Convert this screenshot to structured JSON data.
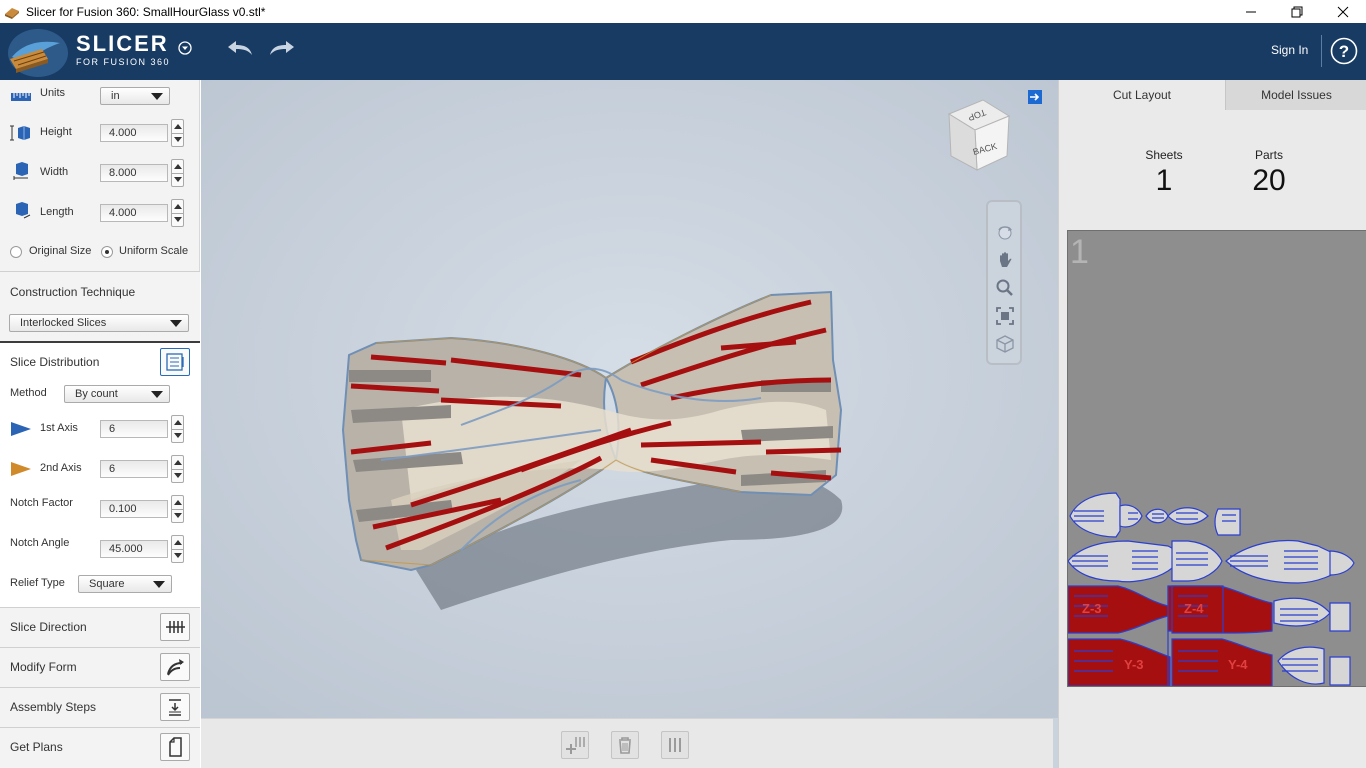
{
  "window": {
    "title": "Slicer for Fusion 360: SmallHourGlass v0.stl*"
  },
  "header": {
    "brand_title": "SLICER",
    "brand_subtitle": "FOR FUSION 360",
    "signin_label": "Sign In",
    "help_label": "?"
  },
  "dimensions": {
    "units_label": "Units",
    "units_value": "in",
    "height_label": "Height",
    "height_value": "4.000",
    "width_label": "Width",
    "width_value": "8.000",
    "length_label": "Length",
    "length_value": "4.000",
    "original_size_label": "Original Size",
    "uniform_scale_label": "Uniform Scale",
    "scale_mode": "Uniform Scale"
  },
  "construction": {
    "title": "Construction Technique",
    "value": "Interlocked Slices"
  },
  "slice_distribution": {
    "title": "Slice Distribution",
    "method_label": "Method",
    "method_value": "By count",
    "axis1_label": "1st Axis",
    "axis1_value": "6",
    "axis2_label": "2nd Axis",
    "axis2_value": "6",
    "notch_factor_label": "Notch Factor",
    "notch_factor_value": "0.100",
    "notch_angle_label": "Notch Angle",
    "notch_angle_value": "45.000",
    "relief_type_label": "Relief Type",
    "relief_type_value": "Square"
  },
  "sections": {
    "slice_direction": "Slice Direction",
    "modify_form": "Modify Form",
    "assembly_steps": "Assembly Steps",
    "get_plans": "Get Plans"
  },
  "viewcube": {
    "top_label": "TOP",
    "back_label": "BACK"
  },
  "right": {
    "tab_cut_layout": "Cut Layout",
    "tab_model_issues": "Model Issues",
    "sheets_label": "Sheets",
    "sheets_value": "1",
    "parts_label": "Parts",
    "parts_value": "20",
    "sheet_number": "1",
    "part_labels": [
      "Z-3",
      "Z-4",
      "Y-3",
      "Y-4"
    ]
  },
  "colors": {
    "header_bg": "#183b63",
    "slice_red": "#a50f0f",
    "part_outline": "#2b3fd0",
    "sheet_bg": "#8e8e8e"
  }
}
